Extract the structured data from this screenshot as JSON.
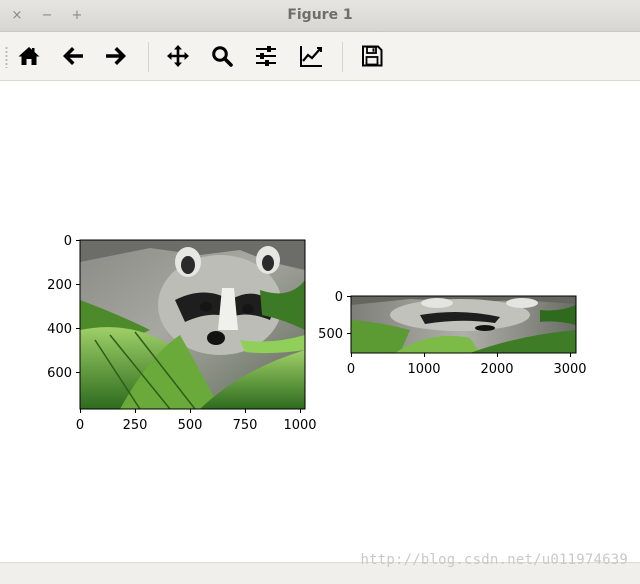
{
  "window": {
    "title": "Figure 1",
    "close_glyph": "×",
    "minimize_glyph": "−",
    "maximize_glyph": "+"
  },
  "toolbar": {
    "items": [
      {
        "name": "home-icon"
      },
      {
        "name": "back-arrow-icon"
      },
      {
        "name": "forward-arrow-icon"
      },
      {
        "name": "pan-move-icon"
      },
      {
        "name": "zoom-magnifier-icon"
      },
      {
        "name": "configure-subplots-icon"
      },
      {
        "name": "edit-axis-curve-icon"
      },
      {
        "name": "save-floppy-icon"
      }
    ]
  },
  "plots": {
    "left": {
      "y_ticks": [
        "0",
        "200",
        "400",
        "600"
      ],
      "x_ticks": [
        "0",
        "250",
        "500",
        "750",
        "1000"
      ]
    },
    "right": {
      "y_ticks": [
        "0",
        "500"
      ],
      "x_ticks": [
        "0",
        "1000",
        "2000",
        "3000"
      ]
    }
  },
  "chart_data": [
    {
      "type": "image",
      "subject": "raccoon photo",
      "x": [
        0,
        250,
        500,
        750,
        1000
      ],
      "y": [
        0,
        200,
        400,
        600
      ],
      "xlim": [
        0,
        1024
      ],
      "ylim": [
        768,
        0
      ]
    },
    {
      "type": "image",
      "subject": "raccoon photo, horizontally stretched",
      "x": [
        0,
        1000,
        2000,
        3000
      ],
      "y": [
        0,
        500
      ],
      "xlim": [
        0,
        3072
      ],
      "ylim": [
        768,
        0
      ]
    }
  ],
  "watermark": "http://blog.csdn.net/u011974639"
}
